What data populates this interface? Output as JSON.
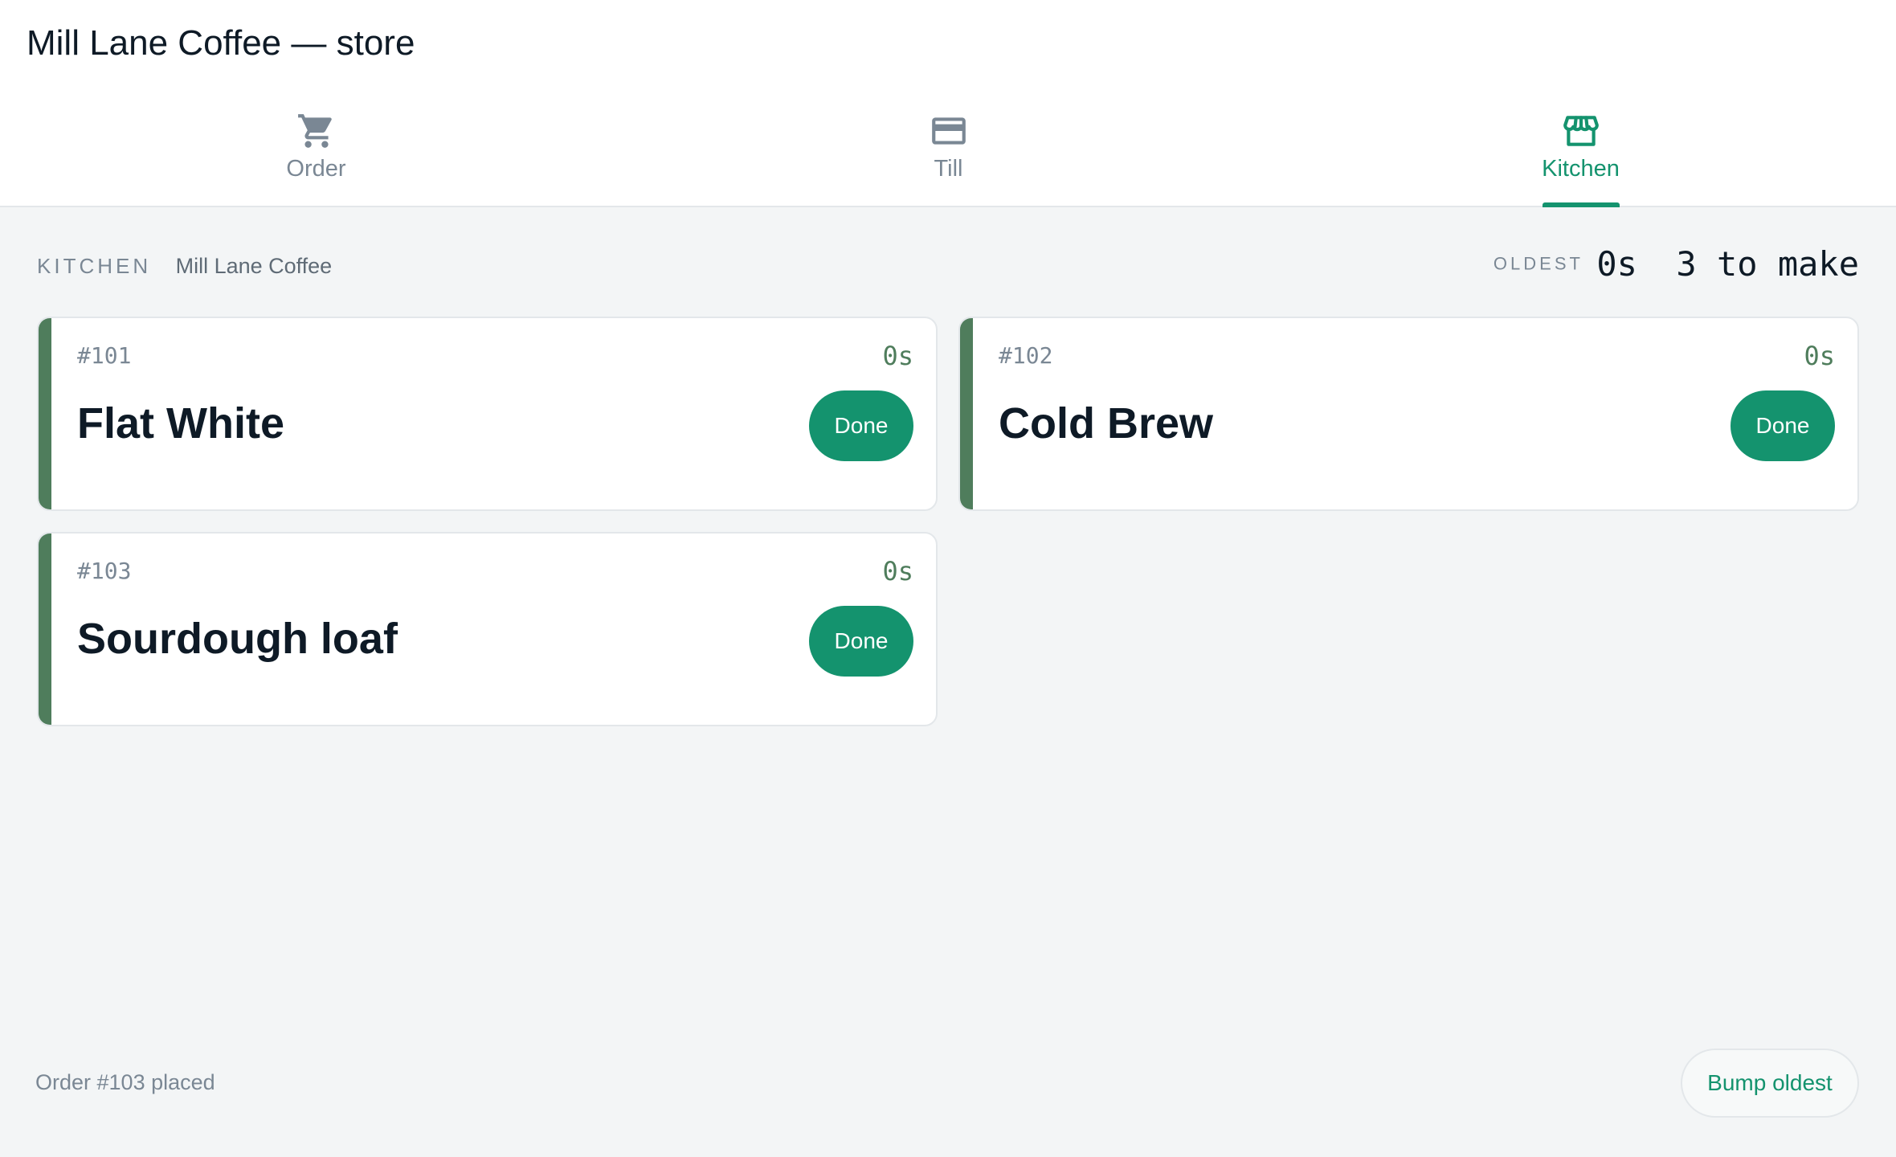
{
  "app": {
    "title": "Mill Lane Coffee — store"
  },
  "tabs": [
    {
      "label": "Order",
      "icon": "cart-icon",
      "active": false
    },
    {
      "label": "Till",
      "icon": "credit-card-icon",
      "active": false
    },
    {
      "label": "Kitchen",
      "icon": "storefront-icon",
      "active": true
    }
  ],
  "kitchen": {
    "section_label": "KITCHEN",
    "store_name": "Mill Lane Coffee",
    "oldest_label": "OLDEST",
    "oldest_value": "0s",
    "queue_count": "3 to make"
  },
  "tickets": [
    {
      "number": "#101",
      "age": "0s",
      "item": "Flat White",
      "done_label": "Done"
    },
    {
      "number": "#102",
      "age": "0s",
      "item": "Cold Brew",
      "done_label": "Done"
    },
    {
      "number": "#103",
      "age": "0s",
      "item": "Sourdough loaf",
      "done_label": "Done"
    }
  ],
  "footer": {
    "status": "Order #103 placed",
    "bump_label": "Bump oldest"
  },
  "colors": {
    "accent": "#14936e",
    "ticket_stripe": "#4f7d5c",
    "background": "#f3f5f6",
    "text": "#0e1a26",
    "muted": "#7a8794"
  }
}
